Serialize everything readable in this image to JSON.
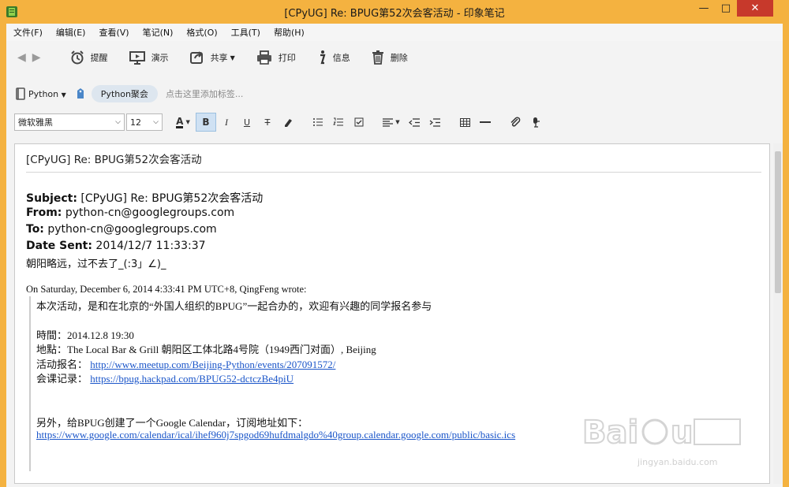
{
  "window": {
    "title": "[CPyUG] Re: BPUG第52次会客活动 - 印象笔记",
    "minimize": "—",
    "maximize": "□",
    "close": "✕"
  },
  "menu": [
    "文件(F)",
    "编辑(E)",
    "查看(V)",
    "笔记(N)",
    "格式(O)",
    "工具(T)",
    "帮助(H)"
  ],
  "toolbar": {
    "back_icon": "arrow-left",
    "forward_icon": "arrow-right",
    "reminder": "提醒",
    "present": "演示",
    "share": "共享",
    "print": "打印",
    "info": "信息",
    "delete": "删除"
  },
  "notebook": {
    "name": "Python",
    "tag": "Python聚会",
    "tag_placeholder": "点击这里添加标签..."
  },
  "format": {
    "font": "微软雅黑",
    "size": "12",
    "font_color": "A",
    "bold": "B",
    "italic": "I",
    "underline": "U",
    "strike": "T"
  },
  "note": {
    "title": "[CPyUG] Re: BPUG第52次会客活动",
    "subject_label": "Subject:",
    "subject_value": " [CPyUG] Re: BPUG第52次会客活动",
    "from_label": "From:",
    "from_value": " python-cn@googlegroups.com",
    "to_label": "To:",
    "to_value": " python-cn@googlegroups.com",
    "date_label": "Date Sent:",
    "date_value": " 2014/12/7 11:33:37",
    "reply_line": "朝阳略远，过不去了_(:3」∠)_",
    "wrote_line": "On Saturday, December 6, 2014 4:33:41 PM UTC+8, QingFeng wrote:",
    "q1": "本次活动，是和在北京的“外国人组织的BPUG”一起合办的，欢迎有兴趣的同学报名参与",
    "time": "時間：2014.12.8 19:30",
    "place": "地點：The Local Bar & Grill 朝阳区工体北路4号院（1949西门对面）, Beijing",
    "signup_label": "活动报名：",
    "signup_link": "http://www.meetup.com/Beijing-Python/events/207091572/",
    "notes_label": "会课记录：",
    "notes_link": "https://bpug.hackpad.com/BPUG52-dctczBe4piU",
    "calendar_line": "另外，给BPUG创建了一个Google Calendar，订阅地址如下：",
    "calendar_link": "https://www.google.com/calendar/ical/ihef960j7spgod69hufdmalgdo%40group.calendar.google.com/public/basic.ics"
  },
  "watermark": {
    "sub": "jingyan.baidu.com"
  }
}
